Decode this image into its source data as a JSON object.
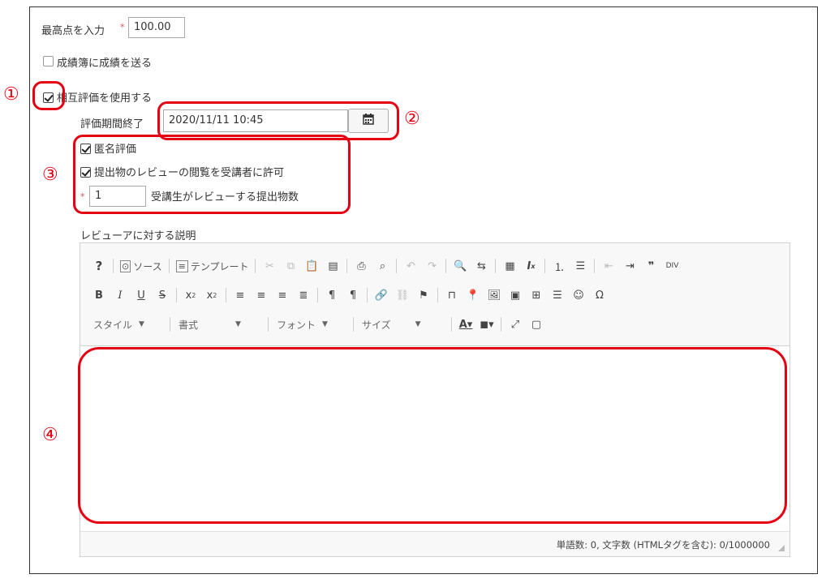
{
  "form": {
    "max_score_label": "最高点を入力",
    "required_mark": "*",
    "max_score_value": "100.00",
    "send_to_gradebook_label": "成績簿に成績を送る",
    "peer_review_label": "相互評価を使用する",
    "review_end_label": "評価期間終了",
    "review_end_value": "2020/11/11 10:45",
    "anonymous_label": "匿名評価",
    "allow_view_label": "提出物のレビューの閲覧を受講者に許可",
    "review_count_value": "1",
    "review_count_label": "受講生がレビューする提出物数",
    "reviewer_instructions_label": "レビューアに対する説明"
  },
  "toolbar": {
    "row1": {
      "help": "?",
      "source": "ソース",
      "templates": "テンプレート"
    },
    "row3": {
      "styles": "スタイル",
      "format": "書式",
      "font": "フォント",
      "size": "サイズ"
    }
  },
  "status": {
    "word_count": "単語数: 0, 文字数 (HTMLタグを含む): 0/1000000"
  },
  "annotations": {
    "m1": "①",
    "m2": "②",
    "m3": "③",
    "m4": "④",
    "color": "#e50012"
  },
  "icons": [
    "calendar-icon",
    "checkmark-icon",
    "bold-icon",
    "italic-icon",
    "underline-icon",
    "strike-icon",
    "link-icon",
    "image-icon",
    "table-icon",
    "smiley-icon",
    "omega-icon",
    "maximize-icon",
    "resize-icon"
  ]
}
